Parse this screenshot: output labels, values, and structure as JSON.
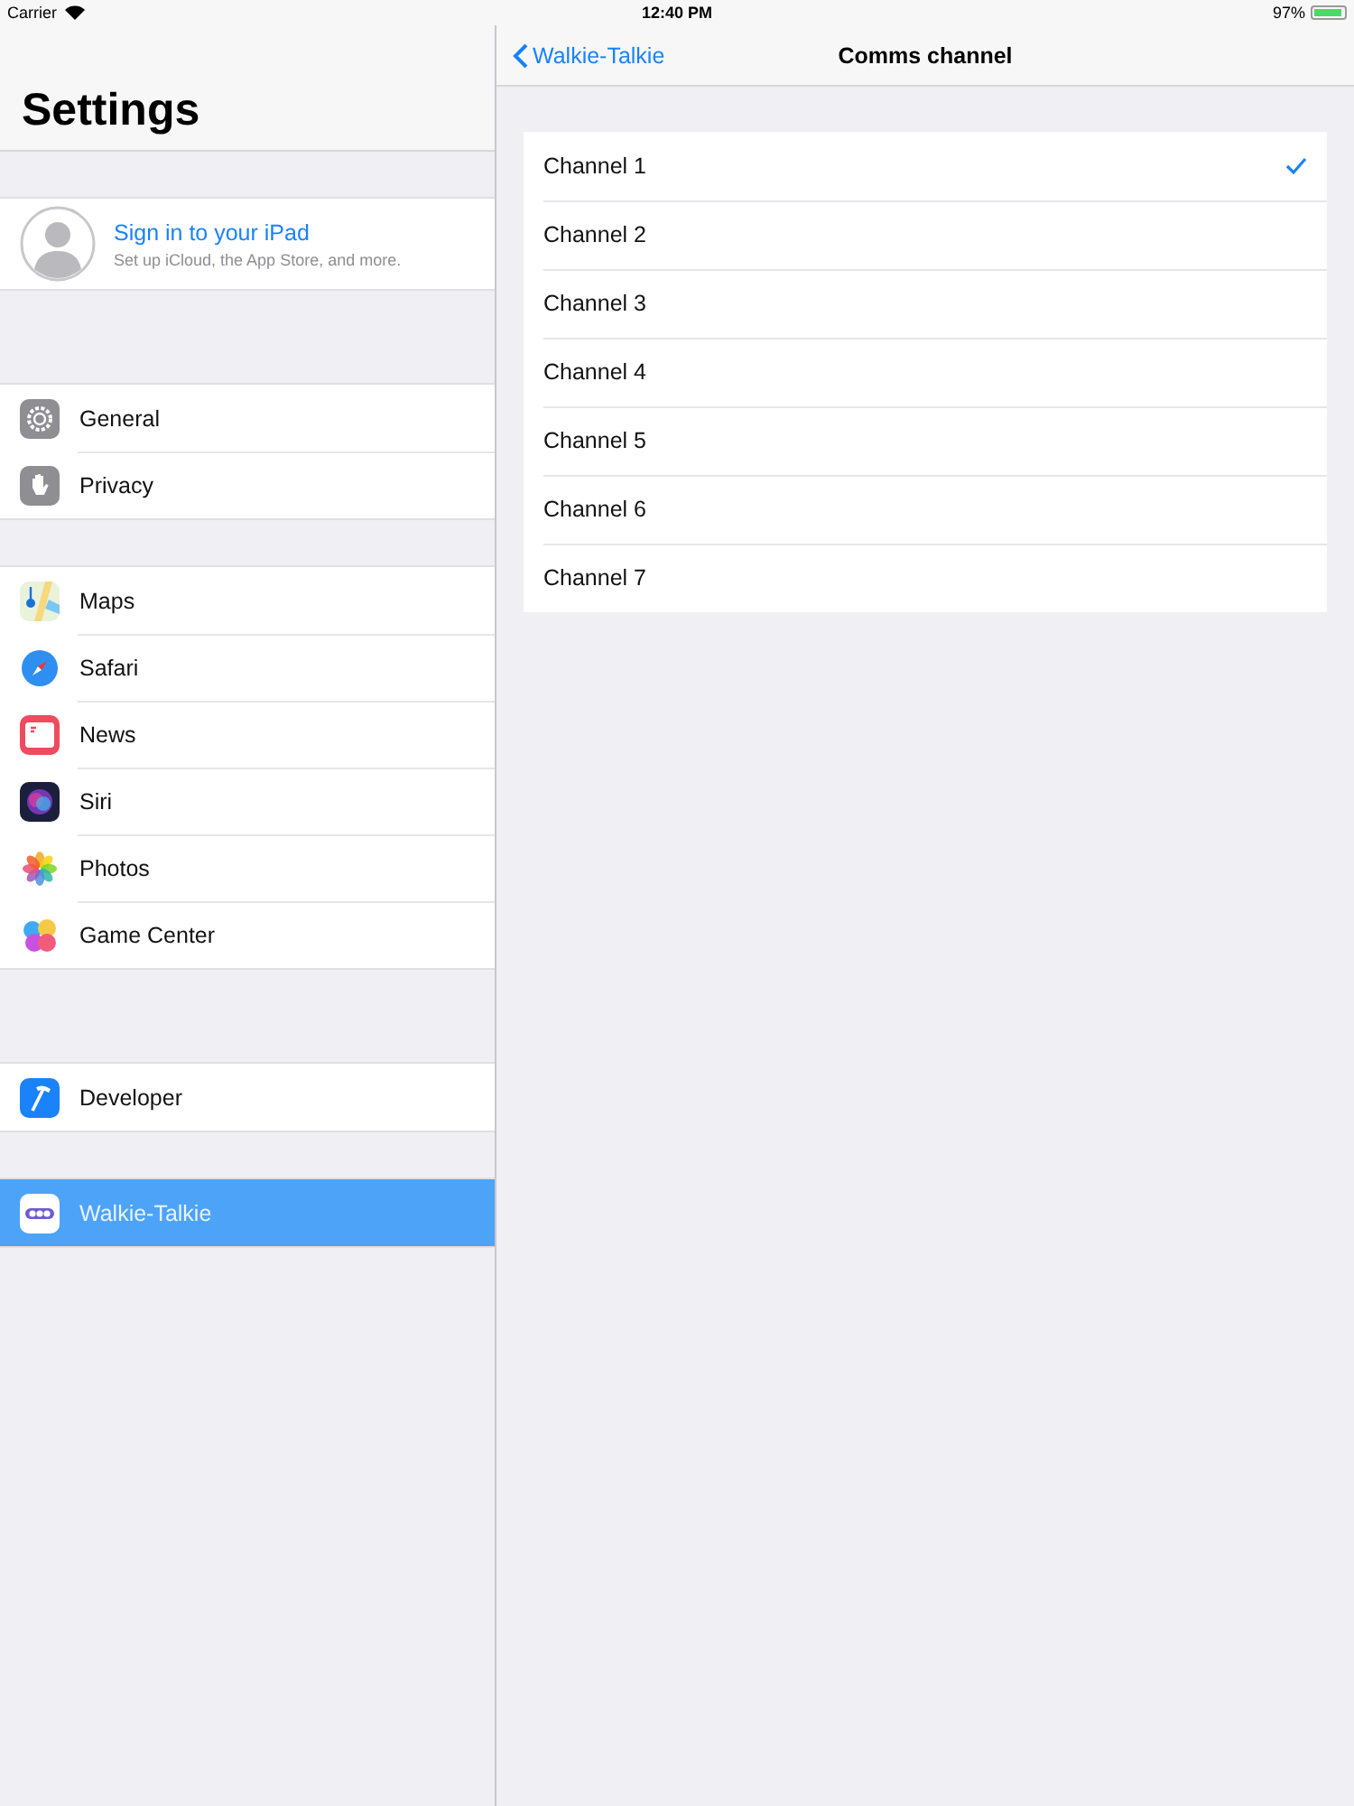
{
  "status_bar": {
    "carrier": "Carrier",
    "time": "12:40 PM",
    "battery": "97%"
  },
  "sidebar": {
    "title": "Settings",
    "profile": {
      "title": "Sign in to your iPad",
      "subtitle": "Set up iCloud, the App Store, and more."
    },
    "groups": [
      [
        {
          "label": "General",
          "kind": "gear",
          "selected": false
        },
        {
          "label": "Privacy",
          "kind": "hand",
          "selected": false
        }
      ],
      [
        {
          "label": "Maps",
          "kind": "maps",
          "selected": false
        },
        {
          "label": "Safari",
          "kind": "safari",
          "selected": false
        },
        {
          "label": "News",
          "kind": "news",
          "selected": false
        },
        {
          "label": "Siri",
          "kind": "siri",
          "selected": false
        },
        {
          "label": "Photos",
          "kind": "photos",
          "selected": false
        },
        {
          "label": "Game Center",
          "kind": "game-center",
          "selected": false
        }
      ],
      [
        {
          "label": "Developer",
          "kind": "hammer",
          "selected": false
        }
      ],
      [
        {
          "label": "Walkie-Talkie",
          "kind": "walkie",
          "selected": true
        }
      ]
    ]
  },
  "detail": {
    "back": "Walkie-Talkie",
    "title": "Comms channel",
    "channels": [
      {
        "label": "Channel 1",
        "selected": true
      },
      {
        "label": "Channel 2",
        "selected": false
      },
      {
        "label": "Channel 3",
        "selected": false
      },
      {
        "label": "Channel 4",
        "selected": false
      },
      {
        "label": "Channel 5",
        "selected": false
      },
      {
        "label": "Channel 6",
        "selected": false
      },
      {
        "label": "Channel 7",
        "selected": false
      }
    ]
  }
}
